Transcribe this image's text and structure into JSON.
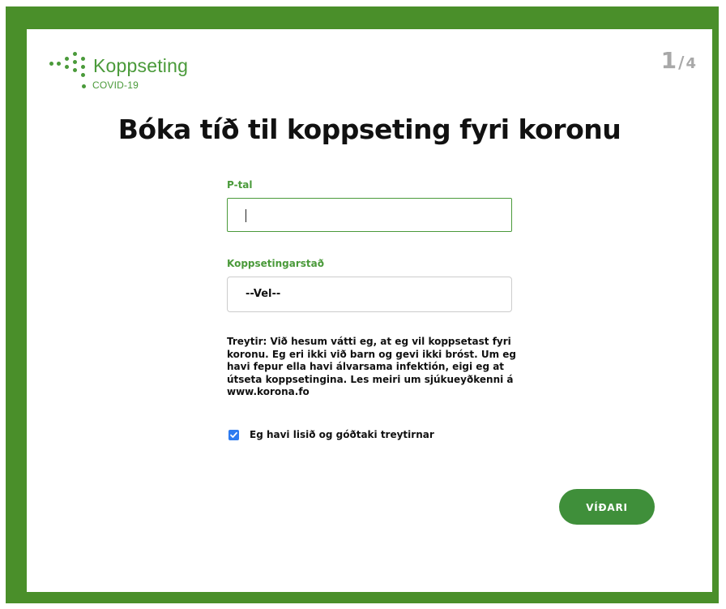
{
  "brand": {
    "name": "Koppseting",
    "subtitle": "COVID-19",
    "color": "#4a9a3a"
  },
  "progress": {
    "current": "1",
    "separator": "/",
    "total": "4"
  },
  "title": "Bóka tíð til koppseting fyri koronu",
  "form": {
    "ptal_label": "P-tal",
    "ptal_value": "",
    "place_label": "Koppsetingarstað",
    "place_selected": "--Vel--",
    "terms_text": "Treytir: Við hesum vátti eg, at eg vil koppsetast fyri koronu. Eg eri ikki við barn og gevi ikki bróst. Um eg havi fepur ella havi álvarsama infektión, eigi eg at útseta koppsetingina. Les meiri um sjúkueyðkenni á www.korona.fo",
    "consent_label": "Eg havi lisið og góðtaki treytirnar",
    "consent_checked": true
  },
  "actions": {
    "next_label": "VÍÐARI"
  },
  "colors": {
    "frame": "#4a8f2a",
    "accent": "#4a9a3a",
    "button": "#3f8f3a",
    "checkbox": "#2d7bf0",
    "counter": "#a8a8a8"
  }
}
